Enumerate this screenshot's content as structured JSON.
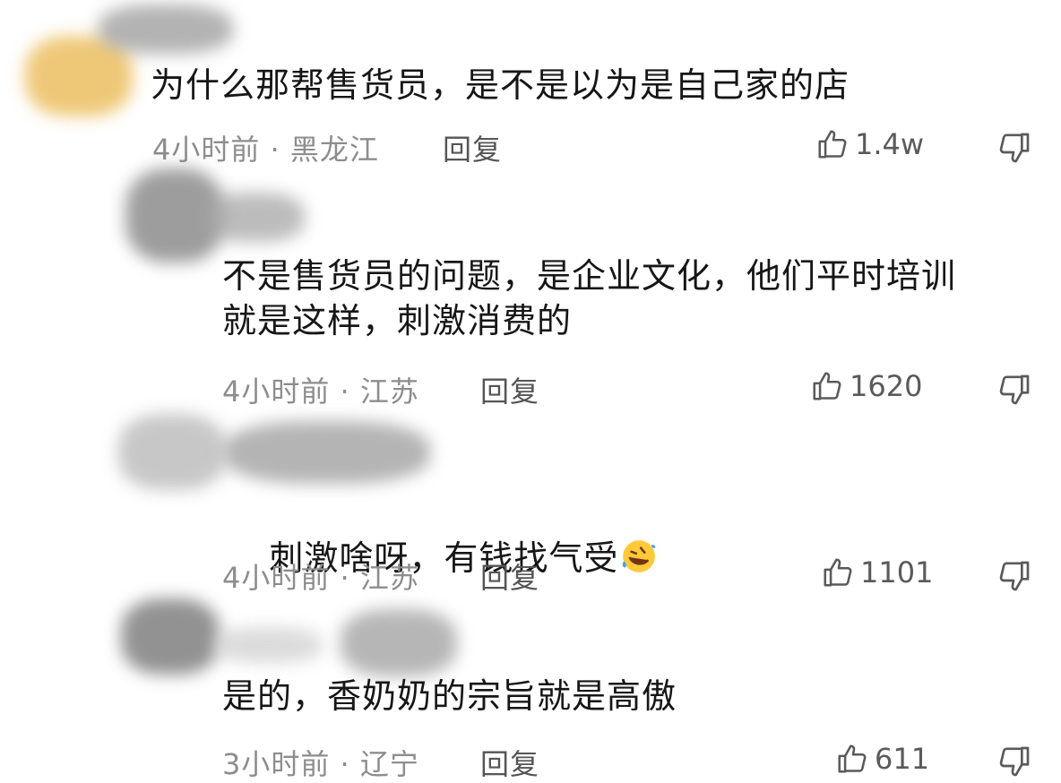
{
  "comments": [
    {
      "text": "为什么那帮售货员，是不是以为是自己家的店",
      "meta": "4小时前 · 黑龙江",
      "reply_label": "回复",
      "likes": "1.4w",
      "avatar_icon": "avatar-redacted",
      "avatar_color": "#e8b84a"
    },
    {
      "text": "不是售货员的问题，是企业文化，他们平时培训\n就是这样，刺激消费的",
      "meta": "4小时前 · 江苏",
      "reply_label": "回复",
      "likes": "1620",
      "avatar_icon": "avatar-redacted"
    },
    {
      "text": "刺激啥呀，有钱找气受",
      "emoji": "rofl-emoji",
      "meta": "4小时前 · 江苏",
      "reply_label": "回复",
      "likes": "1101",
      "avatar_icon": "avatar-redacted"
    },
    {
      "text": "是的，香奶奶的宗旨就是高傲",
      "meta": "3小时前 · 辽宁",
      "reply_label": "回复",
      "likes": "611",
      "avatar_icon": "avatar-redacted"
    }
  ],
  "icons": {
    "like": "thumbs-up-icon",
    "dislike": "thumbs-down-icon"
  }
}
